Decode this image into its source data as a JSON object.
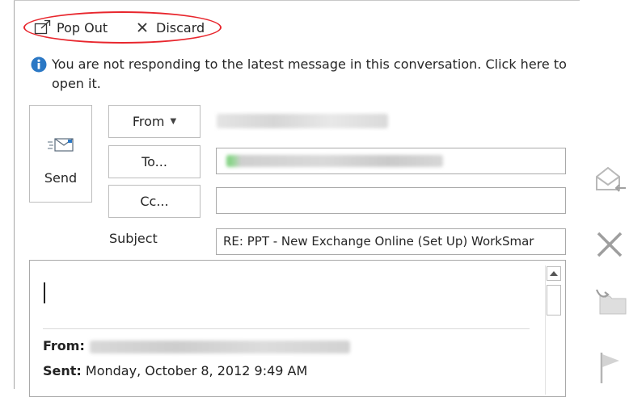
{
  "toolbar": {
    "pop_out_label": "Pop Out",
    "discard_label": "Discard"
  },
  "info": {
    "message": "You are not responding to the latest message in this conversation. Click here to open it."
  },
  "compose": {
    "send_label": "Send",
    "from_label": "From",
    "to_label": "To...",
    "cc_label": "Cc...",
    "subject_label": "Subject",
    "subject_value": "RE: PPT - New Exchange Online (Set Up) WorkSmar"
  },
  "body": {
    "from_label": "From:",
    "sent_label": "Sent:",
    "sent_value": "Monday, October 8, 2012 9:49 AM"
  },
  "colors": {
    "highlight": "#e8262d",
    "info_icon": "#2b78c5"
  }
}
